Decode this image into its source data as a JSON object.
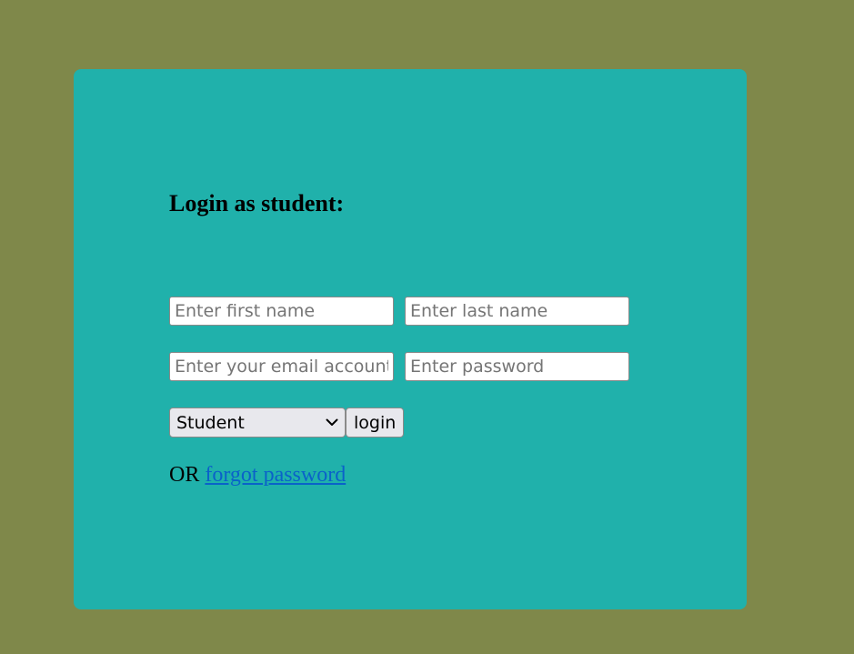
{
  "form": {
    "heading": "Login as student:",
    "first_name_placeholder": "Enter first name",
    "last_name_placeholder": "Enter last name",
    "email_placeholder": "Enter your email account",
    "password_placeholder": "Enter password",
    "role_selected": "Student",
    "login_label": "login",
    "or_text": "OR",
    "forgot_link": "forgot password"
  },
  "colors": {
    "page_background": "#7f884a",
    "card_background": "#20b1ab",
    "link": "#0a62c9"
  },
  "icons": {
    "select_arrow": "chevron-down-icon"
  }
}
